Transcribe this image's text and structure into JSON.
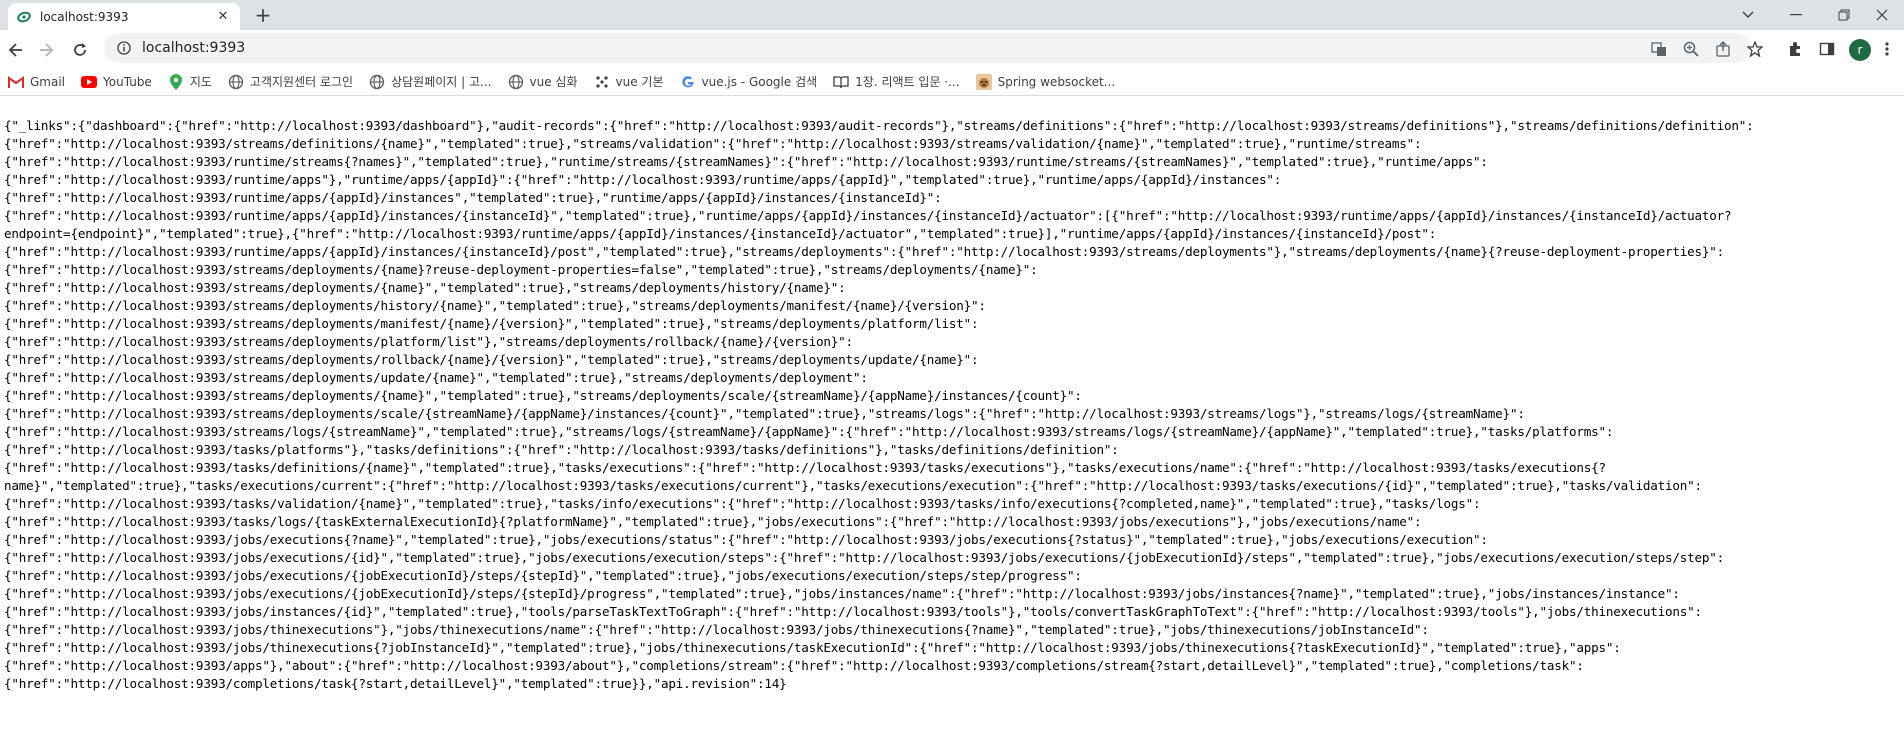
{
  "tab": {
    "title": "localhost:9393",
    "close_icon": "close-icon",
    "favicon": "spring-leaf-icon"
  },
  "toolbar": {
    "url": "localhost:9393",
    "avatar_letter": "r"
  },
  "bookmarks": [
    {
      "label": "Gmail",
      "icon": "gmail-icon",
      "color": "#d93025"
    },
    {
      "label": "YouTube",
      "icon": "youtube-icon",
      "color": "#ff0000"
    },
    {
      "label": "지도",
      "icon": "maps-icon",
      "color": "#34a853"
    },
    {
      "label": "고객지원센터 로그인",
      "icon": "globe-icon",
      "color": "#5f6368"
    },
    {
      "label": "상담원페이지 | 고...",
      "icon": "globe-icon",
      "color": "#5f6368"
    },
    {
      "label": "vue 심화",
      "icon": "globe-icon",
      "color": "#5f6368"
    },
    {
      "label": "vue 기본",
      "icon": "dots-icon",
      "color": "#5f6368"
    },
    {
      "label": "vue.js - Google 검색",
      "icon": "google-icon",
      "color": "#4285f4"
    },
    {
      "label": "1장. 리액트 입문 ·...",
      "icon": "book-icon",
      "color": "#5f6368"
    },
    {
      "label": "Spring websocket...",
      "icon": "dog-icon",
      "color": "#b07a3b"
    }
  ],
  "json_text": "{\"_links\":{\"dashboard\":{\"href\":\"http://localhost:9393/dashboard\"},\"audit-records\":{\"href\":\"http://localhost:9393/audit-records\"},\"streams/definitions\":{\"href\":\"http://localhost:9393/streams/definitions\"},\"streams/definitions/definition\":\n{\"href\":\"http://localhost:9393/streams/definitions/{name}\",\"templated\":true},\"streams/validation\":{\"href\":\"http://localhost:9393/streams/validation/{name}\",\"templated\":true},\"runtime/streams\":\n{\"href\":\"http://localhost:9393/runtime/streams{?names}\",\"templated\":true},\"runtime/streams/{streamNames}\":{\"href\":\"http://localhost:9393/runtime/streams/{streamNames}\",\"templated\":true},\"runtime/apps\":\n{\"href\":\"http://localhost:9393/runtime/apps\"},\"runtime/apps/{appId}\":{\"href\":\"http://localhost:9393/runtime/apps/{appId}\",\"templated\":true},\"runtime/apps/{appId}/instances\":\n{\"href\":\"http://localhost:9393/runtime/apps/{appId}/instances\",\"templated\":true},\"runtime/apps/{appId}/instances/{instanceId}\":\n{\"href\":\"http://localhost:9393/runtime/apps/{appId}/instances/{instanceId}\",\"templated\":true},\"runtime/apps/{appId}/instances/{instanceId}/actuator\":[{\"href\":\"http://localhost:9393/runtime/apps/{appId}/instances/{instanceId}/actuator?\nendpoint={endpoint}\",\"templated\":true},{\"href\":\"http://localhost:9393/runtime/apps/{appId}/instances/{instanceId}/actuator\",\"templated\":true}],\"runtime/apps/{appId}/instances/{instanceId}/post\":\n{\"href\":\"http://localhost:9393/runtime/apps/{appId}/instances/{instanceId}/post\",\"templated\":true},\"streams/deployments\":{\"href\":\"http://localhost:9393/streams/deployments\"},\"streams/deployments/{name}{?reuse-deployment-properties}\":\n{\"href\":\"http://localhost:9393/streams/deployments/{name}?reuse-deployment-properties=false\",\"templated\":true},\"streams/deployments/{name}\":\n{\"href\":\"http://localhost:9393/streams/deployments/{name}\",\"templated\":true},\"streams/deployments/history/{name}\":\n{\"href\":\"http://localhost:9393/streams/deployments/history/{name}\",\"templated\":true},\"streams/deployments/manifest/{name}/{version}\":\n{\"href\":\"http://localhost:9393/streams/deployments/manifest/{name}/{version}\",\"templated\":true},\"streams/deployments/platform/list\":\n{\"href\":\"http://localhost:9393/streams/deployments/platform/list\"},\"streams/deployments/rollback/{name}/{version}\":\n{\"href\":\"http://localhost:9393/streams/deployments/rollback/{name}/{version}\",\"templated\":true},\"streams/deployments/update/{name}\":\n{\"href\":\"http://localhost:9393/streams/deployments/update/{name}\",\"templated\":true},\"streams/deployments/deployment\":\n{\"href\":\"http://localhost:9393/streams/deployments/{name}\",\"templated\":true},\"streams/deployments/scale/{streamName}/{appName}/instances/{count}\":\n{\"href\":\"http://localhost:9393/streams/deployments/scale/{streamName}/{appName}/instances/{count}\",\"templated\":true},\"streams/logs\":{\"href\":\"http://localhost:9393/streams/logs\"},\"streams/logs/{streamName}\":\n{\"href\":\"http://localhost:9393/streams/logs/{streamName}\",\"templated\":true},\"streams/logs/{streamName}/{appName}\":{\"href\":\"http://localhost:9393/streams/logs/{streamName}/{appName}\",\"templated\":true},\"tasks/platforms\":\n{\"href\":\"http://localhost:9393/tasks/platforms\"},\"tasks/definitions\":{\"href\":\"http://localhost:9393/tasks/definitions\"},\"tasks/definitions/definition\":\n{\"href\":\"http://localhost:9393/tasks/definitions/{name}\",\"templated\":true},\"tasks/executions\":{\"href\":\"http://localhost:9393/tasks/executions\"},\"tasks/executions/name\":{\"href\":\"http://localhost:9393/tasks/executions{?\nname}\",\"templated\":true},\"tasks/executions/current\":{\"href\":\"http://localhost:9393/tasks/executions/current\"},\"tasks/executions/execution\":{\"href\":\"http://localhost:9393/tasks/executions/{id}\",\"templated\":true},\"tasks/validation\":\n{\"href\":\"http://localhost:9393/tasks/validation/{name}\",\"templated\":true},\"tasks/info/executions\":{\"href\":\"http://localhost:9393/tasks/info/executions{?completed,name}\",\"templated\":true},\"tasks/logs\":\n{\"href\":\"http://localhost:9393/tasks/logs/{taskExternalExecutionId}{?platformName}\",\"templated\":true},\"jobs/executions\":{\"href\":\"http://localhost:9393/jobs/executions\"},\"jobs/executions/name\":\n{\"href\":\"http://localhost:9393/jobs/executions{?name}\",\"templated\":true},\"jobs/executions/status\":{\"href\":\"http://localhost:9393/jobs/executions{?status}\",\"templated\":true},\"jobs/executions/execution\":\n{\"href\":\"http://localhost:9393/jobs/executions/{id}\",\"templated\":true},\"jobs/executions/execution/steps\":{\"href\":\"http://localhost:9393/jobs/executions/{jobExecutionId}/steps\",\"templated\":true},\"jobs/executions/execution/steps/step\":\n{\"href\":\"http://localhost:9393/jobs/executions/{jobExecutionId}/steps/{stepId}\",\"templated\":true},\"jobs/executions/execution/steps/step/progress\":\n{\"href\":\"http://localhost:9393/jobs/executions/{jobExecutionId}/steps/{stepId}/progress\",\"templated\":true},\"jobs/instances/name\":{\"href\":\"http://localhost:9393/jobs/instances{?name}\",\"templated\":true},\"jobs/instances/instance\":\n{\"href\":\"http://localhost:9393/jobs/instances/{id}\",\"templated\":true},\"tools/parseTaskTextToGraph\":{\"href\":\"http://localhost:9393/tools\"},\"tools/convertTaskGraphToText\":{\"href\":\"http://localhost:9393/tools\"},\"jobs/thinexecutions\":\n{\"href\":\"http://localhost:9393/jobs/thinexecutions\"},\"jobs/thinexecutions/name\":{\"href\":\"http://localhost:9393/jobs/thinexecutions{?name}\",\"templated\":true},\"jobs/thinexecutions/jobInstanceId\":\n{\"href\":\"http://localhost:9393/jobs/thinexecutions{?jobInstanceId}\",\"templated\":true},\"jobs/thinexecutions/taskExecutionId\":{\"href\":\"http://localhost:9393/jobs/thinexecutions{?taskExecutionId}\",\"templated\":true},\"apps\":\n{\"href\":\"http://localhost:9393/apps\"},\"about\":{\"href\":\"http://localhost:9393/about\"},\"completions/stream\":{\"href\":\"http://localhost:9393/completions/stream{?start,detailLevel}\",\"templated\":true},\"completions/task\":\n{\"href\":\"http://localhost:9393/completions/task{?start,detailLevel}\",\"templated\":true}},\"api.revision\":14}"
}
